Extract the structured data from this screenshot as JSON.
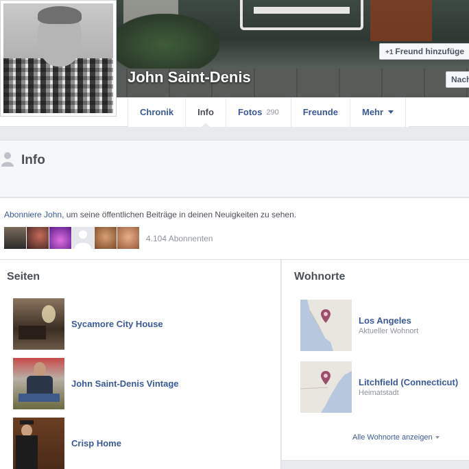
{
  "profile": {
    "name": "John Saint-Denis",
    "add_friend_label": "Freund hinzufüge",
    "add_friend_prefix": "+1",
    "follow_label": "Nach"
  },
  "tabs": [
    {
      "label": "Chronik"
    },
    {
      "label": "Info"
    },
    {
      "label": "Fotos",
      "count": "290"
    },
    {
      "label": "Freunde"
    },
    {
      "label": "Mehr"
    }
  ],
  "info": {
    "title": "Info",
    "follow_link": "Abonniere John",
    "follow_text": ", um seine öffentlichen Beiträge in deinen Neuigkeiten zu sehen.",
    "subscriber_count": "4.104 Abonnenten"
  },
  "pages_section": {
    "title": "Seiten",
    "items": [
      {
        "label": "Sycamore City House"
      },
      {
        "label": "John Saint-Denis Vintage"
      },
      {
        "label": "Crisp Home"
      }
    ]
  },
  "places_section": {
    "title": "Wohnorte",
    "items": [
      {
        "name": "Los Angeles",
        "sub": "Aktueller Wohnort"
      },
      {
        "name": "Litchfield (Connecticut)",
        "sub": "Heimatstadt"
      }
    ],
    "show_all": "Alle Wohnorte anzeigen"
  },
  "colors": {
    "link": "#3b5998",
    "text": "#4b4f56",
    "muted": "#90949c",
    "background": "#e9eaed",
    "pin": "#9c4f6a"
  }
}
